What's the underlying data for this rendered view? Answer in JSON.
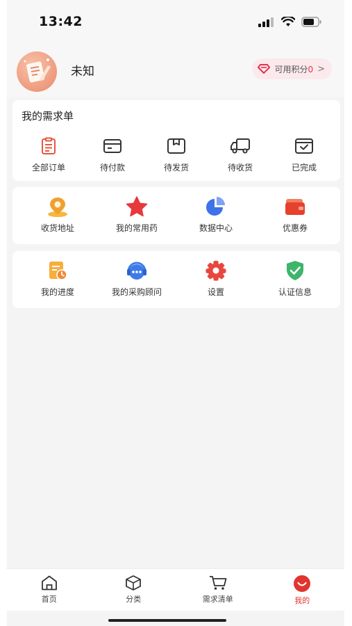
{
  "status_bar": {
    "time": "13:42"
  },
  "profile": {
    "username": "未知",
    "points_label": "可用积分",
    "points_value": "0",
    "points_chevron": ">"
  },
  "orders": {
    "title": "我的需求单",
    "items": [
      {
        "label": "全部订单",
        "icon": "order-list-icon"
      },
      {
        "label": "待付款",
        "icon": "wallet-card-icon"
      },
      {
        "label": "待发货",
        "icon": "package-box-icon"
      },
      {
        "label": "待收货",
        "icon": "delivery-truck-icon"
      },
      {
        "label": "已完成",
        "icon": "completed-box-icon"
      }
    ]
  },
  "services": {
    "items": [
      {
        "label": "收货地址",
        "icon": "location-pin-icon"
      },
      {
        "label": "我的常用药",
        "icon": "star-icon"
      },
      {
        "label": "数据中心",
        "icon": "pie-chart-icon"
      },
      {
        "label": "优惠券",
        "icon": "coupon-icon"
      }
    ]
  },
  "more": {
    "items": [
      {
        "label": "我的进度",
        "icon": "progress-doc-icon"
      },
      {
        "label": "我的采购顾问",
        "icon": "advisor-chat-icon"
      },
      {
        "label": "设置",
        "icon": "gear-icon"
      },
      {
        "label": "认证信息",
        "icon": "verified-shield-icon"
      }
    ]
  },
  "tab_bar": {
    "tabs": [
      {
        "label": "首页",
        "icon": "home-icon"
      },
      {
        "label": "分类",
        "icon": "category-box-icon"
      },
      {
        "label": "需求清单",
        "icon": "cart-icon"
      },
      {
        "label": "我的",
        "icon": "profile-smile-icon"
      }
    ],
    "active_index": 3
  },
  "colors": {
    "accent": "#e2342f",
    "order_icon_active": "#e8553d",
    "order_icon": "#333333",
    "background": "#f4f4f4"
  }
}
